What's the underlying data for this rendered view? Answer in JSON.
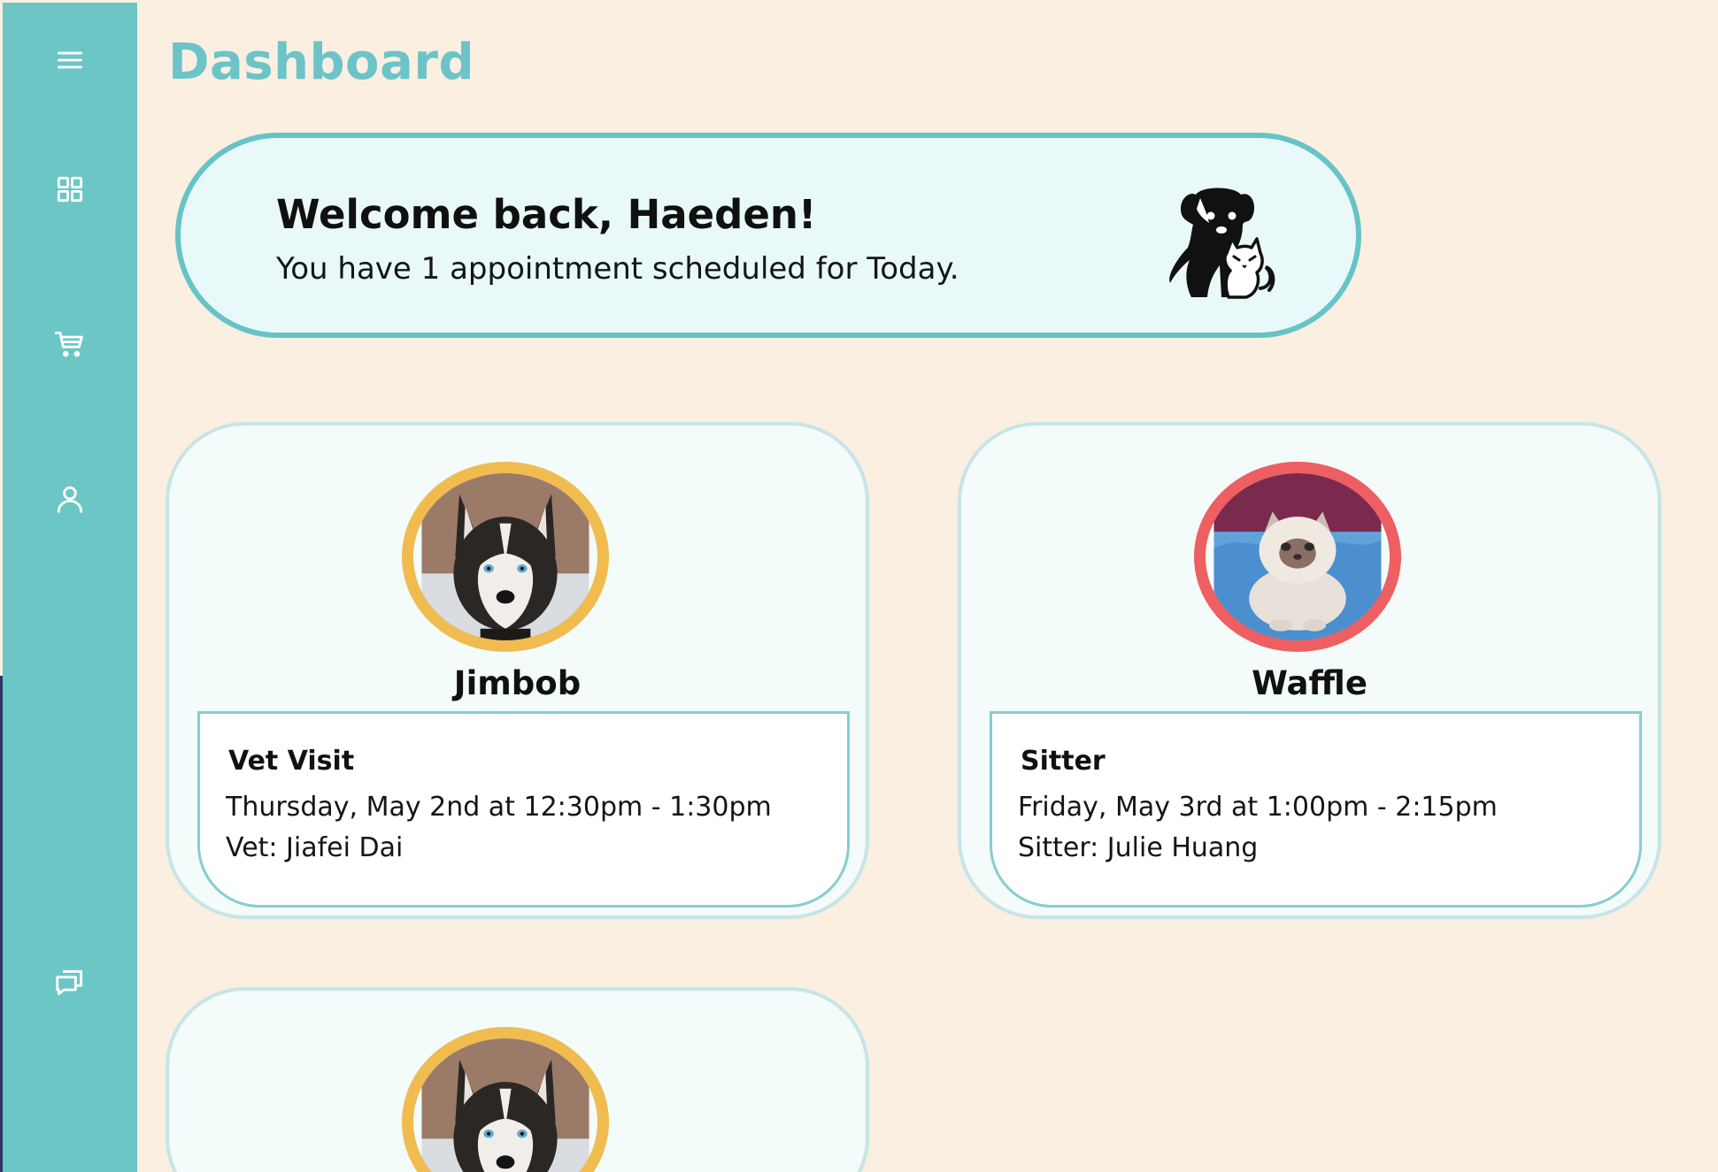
{
  "page": {
    "title": "Dashboard"
  },
  "sidebar": {
    "items": [
      {
        "icon": "menu-icon",
        "name": "menu"
      },
      {
        "icon": "grid-icon",
        "name": "dashboard"
      },
      {
        "icon": "cart-icon",
        "name": "shop"
      },
      {
        "icon": "user-icon",
        "name": "profile"
      },
      {
        "icon": "chat-icon",
        "name": "messages"
      }
    ],
    "icon_color": "#ffffff",
    "background": "#6cc6c6"
  },
  "welcome": {
    "heading": "Welcome back, Haeden!",
    "subtitle": "You have 1 appointment scheduled for Today.",
    "logo_icon": "dog-cat-logo-icon"
  },
  "pets": [
    {
      "name": "Jimbob",
      "avatar_ring_color": "#f0bc4f",
      "appointment": {
        "type": "Vet Visit",
        "time": "Thursday, May 2nd at 12:30pm - 1:30pm",
        "provider": "Vet: Jiafei Dai"
      }
    },
    {
      "name": "Waffle",
      "avatar_ring_color": "#ee5f61",
      "appointment": {
        "type": "Sitter",
        "time": "Friday, May 3rd at 1:00pm - 2:15pm",
        "provider": "Sitter: Julie Huang"
      }
    },
    {
      "name": "",
      "avatar_ring_color": "#f0bc4f"
    }
  ],
  "colors": {
    "accent": "#6cc3c8",
    "background": "#faefe1",
    "card_border": "#c7e5e7"
  }
}
